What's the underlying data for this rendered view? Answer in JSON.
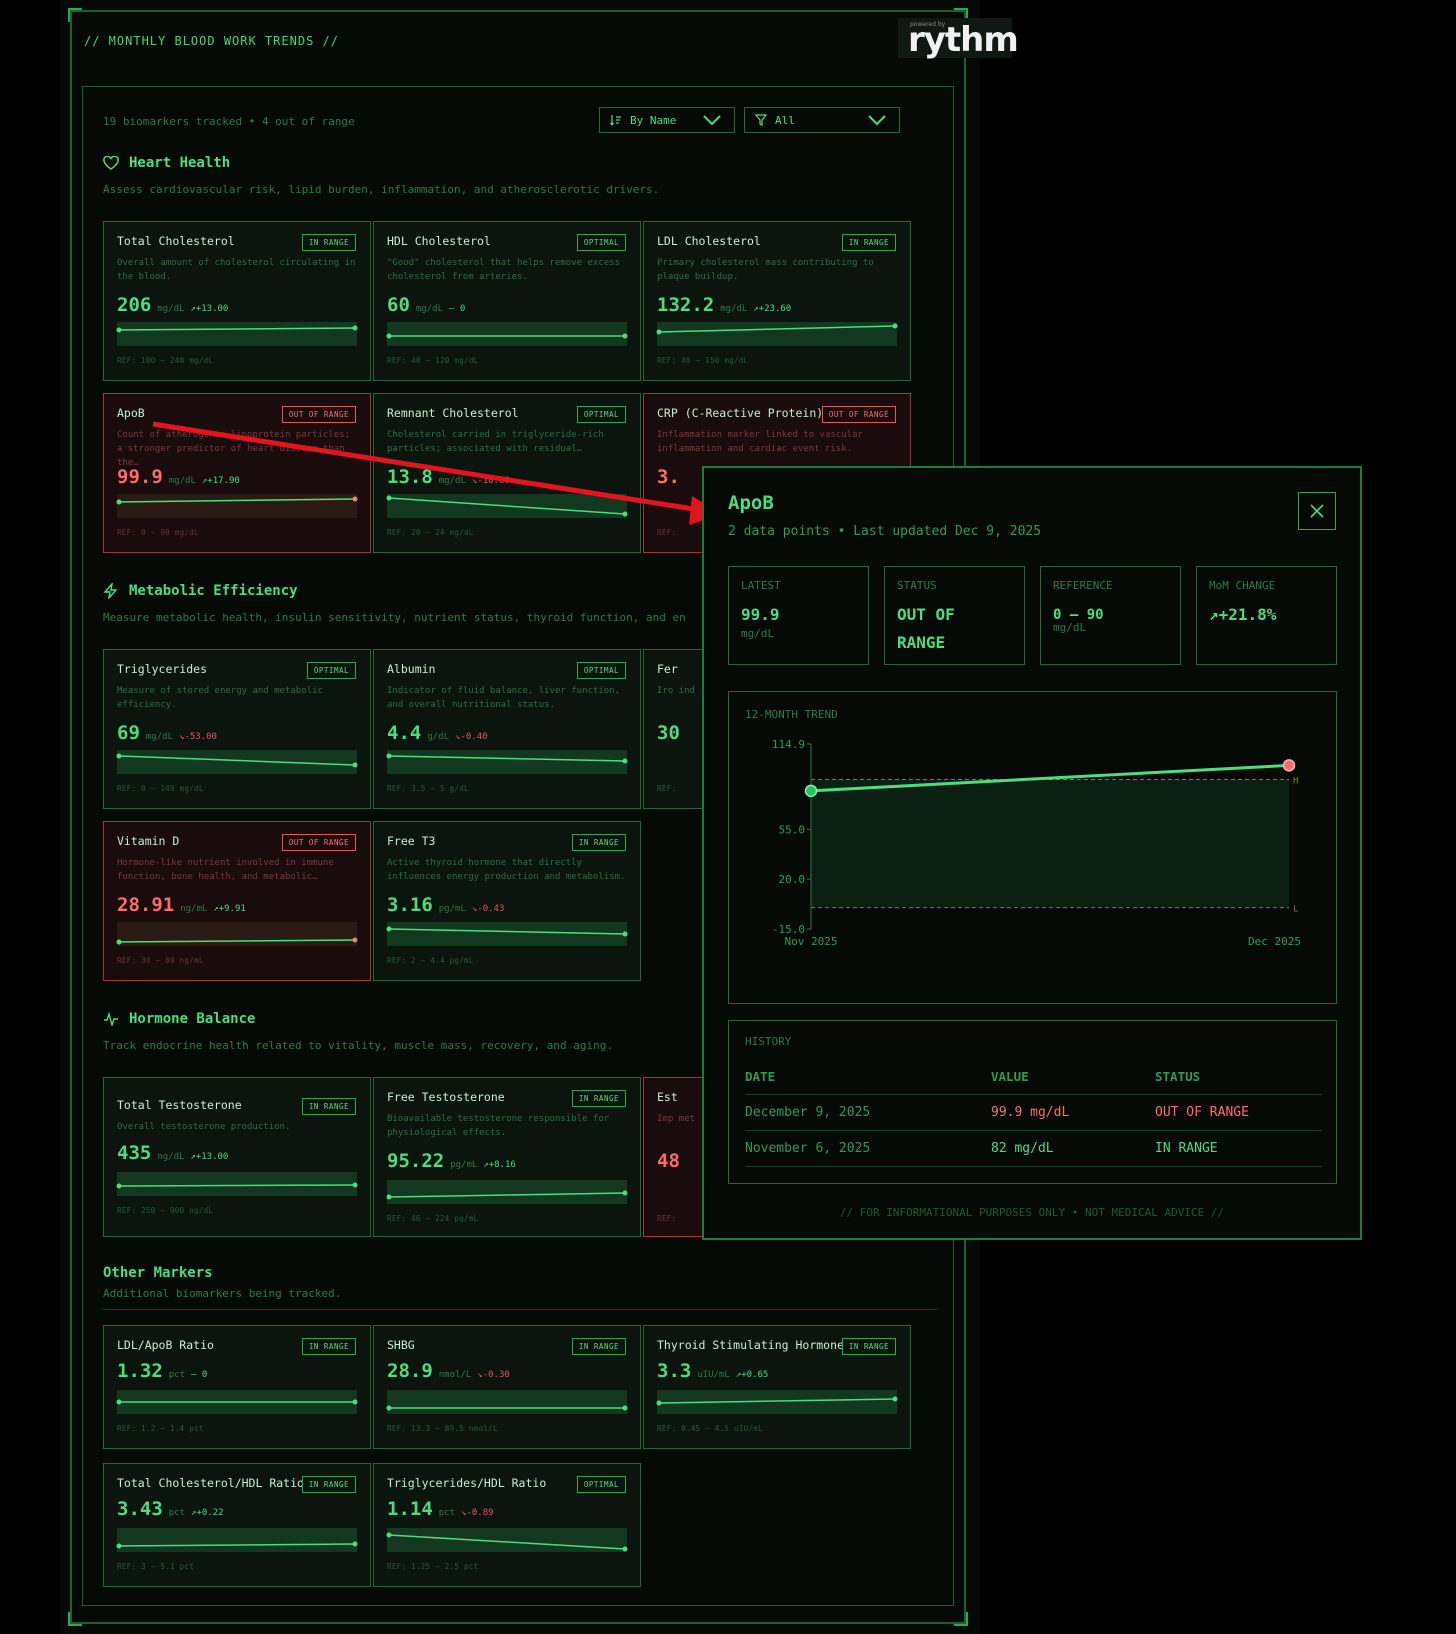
{
  "header": {
    "title": "// MONTHLY BLOOD WORK TRENDS //",
    "logo_small": "powered by",
    "logo_word": "rythm"
  },
  "summary": "19 biomarkers tracked • 4 out of range",
  "sort": {
    "label": "By Name"
  },
  "filter": {
    "label": "All"
  },
  "colors": {
    "accent": "#4ade80",
    "danger": "#ff6b6b",
    "border": "#1f6a38",
    "background": "#050a06"
  },
  "sections": {
    "heart": {
      "title": "Heart Health",
      "icon": "heart-icon",
      "desc": "Assess cardiovascular risk, lipid burden, inflammation, and atherosclerotic drivers."
    },
    "metabolic": {
      "title": "Metabolic Efficiency",
      "icon": "bolt-icon",
      "desc": "Measure metabolic health, insulin sensitivity, nutrient status, thyroid function, and en"
    },
    "hormone": {
      "title": "Hormone Balance",
      "icon": "pulse-icon",
      "desc": "Track endocrine health related to vitality, muscle mass, recovery, and aging."
    },
    "other": {
      "title": "Other Markers",
      "desc": "Additional biomarkers being tracked."
    }
  },
  "cards": {
    "total_chol": {
      "name": "Total Cholesterol",
      "badge": "IN RANGE",
      "desc": "Overall amount of cholesterol circulating in the blood.",
      "value": "206",
      "unit": "mg/dL",
      "delta": "↗+13.00",
      "ref": "REF: 100 – 240 mg/dL"
    },
    "hdl": {
      "name": "HDL Cholesterol",
      "badge": "OPTIMAL",
      "desc": "\"Good\" cholesterol that helps remove excess cholesterol from arteries.",
      "value": "60",
      "unit": "mg/dL",
      "delta": "— 0",
      "ref": "REF: 40 – 120 mg/dL"
    },
    "ldl": {
      "name": "LDL Cholesterol",
      "badge": "IN RANGE",
      "desc": "Primary cholesterol mass contributing to plaque buildup.",
      "value": "132.2",
      "unit": "mg/dL",
      "delta": "↗+23.60",
      "ref": "REF: 40 – 150 mg/dL"
    },
    "apob": {
      "name": "ApoB",
      "badge": "OUT OF RANGE",
      "desc": "Count of atherogenic lipoprotein particles; a stronger predictor of heart disease than the…",
      "value": "99.9",
      "unit": "mg/dL",
      "delta": "↗+17.90",
      "ref": "REF: 0 – 90 mg/dL"
    },
    "remnant": {
      "name": "Remnant Cholesterol",
      "badge": "OPTIMAL",
      "desc": "Cholesterol carried in triglyceride-rich particles; associated with residual…",
      "value": "13.8",
      "unit": "mg/dL",
      "delta": "↘-10.60",
      "ref": "REF: 20 – 24 mg/dL"
    },
    "crp": {
      "name": "CRP (C-Reactive Protein)",
      "badge": "OUT OF RANGE",
      "desc": "Inflammation marker linked to vascular inflammation and cardiac event risk.",
      "value": "3.",
      "unit": "",
      "delta": "",
      "ref": "REF:"
    },
    "trig": {
      "name": "Triglycerides",
      "badge": "OPTIMAL",
      "desc": "Measure of stored energy and metabolic efficiency.",
      "value": "69",
      "unit": "mg/dL",
      "delta": "↘-53.00",
      "ref": "REF: 0 – 149 mg/dL"
    },
    "albumin": {
      "name": "Albumin",
      "badge": "OPTIMAL",
      "desc": "Indicator of fluid balance, liver function, and overall nutritional status.",
      "value": "4.4",
      "unit": "g/dL",
      "delta": "↘-0.40",
      "ref": "REF: 3.5 – 5 g/dL"
    },
    "fer": {
      "name": "Fer",
      "badge": "",
      "desc": "Iro ind",
      "value": "30",
      "unit": "",
      "delta": "",
      "ref": "REF:"
    },
    "vitd": {
      "name": "Vitamin D",
      "badge": "OUT OF RANGE",
      "desc": "Hormone-like nutrient involved in immune function, bone health, and metabolic…",
      "value": "28.91",
      "unit": "ng/mL",
      "delta": "↗+9.91",
      "ref": "REF: 30 – 80 ng/mL"
    },
    "t3": {
      "name": "Free T3",
      "badge": "IN RANGE",
      "desc": "Active thyroid hormone that directly influences energy production and metabolism.",
      "value": "3.16",
      "unit": "pg/mL",
      "delta": "↘-0.43",
      "ref": "REF: 2 – 4.4 pg/mL"
    },
    "ttest": {
      "name": "Total Testosterone",
      "badge": "IN RANGE",
      "desc": "Overall testosterone production.",
      "value": "435",
      "unit": "ng/dL",
      "delta": "↗+13.00",
      "ref": "REF: 250 – 900 ng/dL"
    },
    "ftest": {
      "name": "Free Testosterone",
      "badge": "IN RANGE",
      "desc": "Bioavailable testosterone responsible for physiological effects.",
      "value": "95.22",
      "unit": "pg/mL",
      "delta": "↗+8.16",
      "ref": "REF: 46 – 224 pg/mL"
    },
    "est": {
      "name": "Est",
      "badge": "",
      "desc": "Imp met",
      "value": "48",
      "unit": "",
      "delta": "",
      "ref": "REF:"
    },
    "ldlapob": {
      "name": "LDL/ApoB Ratio",
      "badge": "IN RANGE",
      "desc": "",
      "value": "1.32",
      "unit": "pct",
      "delta": "— 0",
      "ref": "REF: 1.2 – 1.4 pct"
    },
    "shbg": {
      "name": "SHBG",
      "badge": "IN RANGE",
      "desc": "",
      "value": "28.9",
      "unit": "nmol/L",
      "delta": "↘-0.30",
      "ref": "REF: 13.3 – 89.5 nmol/L"
    },
    "tsh": {
      "name": "Thyroid Stimulating Hormone",
      "badge": "IN RANGE",
      "desc": "",
      "value": "3.3",
      "unit": "uIU/mL",
      "delta": "↗+0.65",
      "ref": "REF: 0.45 – 4.5 uIU/mL"
    },
    "tchdl": {
      "name": "Total Cholesterol/HDL Ratio",
      "badge": "IN RANGE",
      "desc": "",
      "value": "3.43",
      "unit": "pct",
      "delta": "↗+0.22",
      "ref": "REF: 3 – 5.1 pct"
    },
    "tghdl": {
      "name": "Triglycerides/HDL Ratio",
      "badge": "OPTIMAL",
      "desc": "",
      "value": "1.14",
      "unit": "pct",
      "delta": "↘-0.89",
      "ref": "REF: 1.25 – 2.5 pct"
    }
  },
  "modal": {
    "title": "ApoB",
    "subtitle": "2 data points • Last updated Dec 9, 2025",
    "stats": {
      "latest": {
        "label": "LATEST",
        "value": "99.9",
        "unit": "mg/dL"
      },
      "status": {
        "label": "STATUS",
        "value_line1": "OUT OF",
        "value_line2": "RANGE"
      },
      "reference": {
        "label": "REFERENCE",
        "value": "0 – 90",
        "unit": "mg/dL"
      },
      "mom": {
        "label": "MoM CHANGE",
        "value": "↗+21.8%"
      }
    },
    "trend_label": "12-MONTH TREND",
    "chart_data": {
      "type": "line",
      "x": [
        "Nov 2025",
        "Dec 2025"
      ],
      "series": [
        {
          "values": [
            82,
            99.9
          ]
        }
      ],
      "yticks": [
        "114.9",
        "55.0",
        "20.0",
        "-15.0"
      ],
      "ylim": [
        -15,
        114.9
      ],
      "reference_range": [
        0,
        90
      ],
      "reference_labels": [
        "H",
        "L"
      ]
    },
    "history": {
      "label": "HISTORY",
      "headers": [
        "DATE",
        "VALUE",
        "STATUS"
      ],
      "rows": [
        {
          "date": "December 9, 2025",
          "value": "99.9 mg/dL",
          "status": "OUT OF RANGE"
        },
        {
          "date": "November 6, 2025",
          "value": "82 mg/dL",
          "status": "IN RANGE"
        }
      ]
    },
    "disclaimer": "// FOR INFORMATIONAL PURPOSES ONLY • NOT MEDICAL ADVICE //"
  }
}
